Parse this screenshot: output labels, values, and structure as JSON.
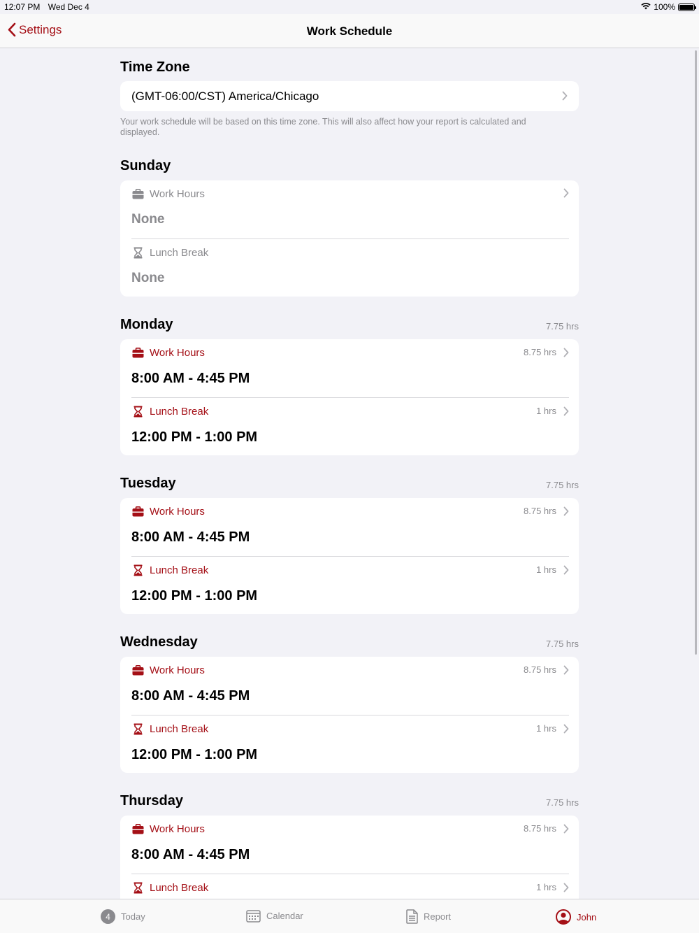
{
  "status_bar": {
    "time": "12:07 PM",
    "date": "Wed Dec 4",
    "battery": "100%"
  },
  "nav": {
    "back_label": "Settings",
    "title": "Work Schedule"
  },
  "time_zone": {
    "header": "Time Zone",
    "value": "(GMT-06:00/CST) America/Chicago",
    "footer": "Your work schedule will be based on this time zone. This will also affect how your report is calculated and displayed."
  },
  "days": [
    {
      "name": "Sunday",
      "total": "",
      "work": {
        "label": "Work Hours",
        "hours": "",
        "value": "None"
      },
      "lunch": {
        "label": "Lunch Break",
        "hours": "",
        "value": "None"
      }
    },
    {
      "name": "Monday",
      "total": "7.75 hrs",
      "work": {
        "label": "Work Hours",
        "hours": "8.75 hrs",
        "value": "8:00 AM - 4:45 PM"
      },
      "lunch": {
        "label": "Lunch Break",
        "hours": "1 hrs",
        "value": "12:00 PM - 1:00 PM"
      }
    },
    {
      "name": "Tuesday",
      "total": "7.75 hrs",
      "work": {
        "label": "Work Hours",
        "hours": "8.75 hrs",
        "value": "8:00 AM - 4:45 PM"
      },
      "lunch": {
        "label": "Lunch Break",
        "hours": "1 hrs",
        "value": "12:00 PM - 1:00 PM"
      }
    },
    {
      "name": "Wednesday",
      "total": "7.75 hrs",
      "work": {
        "label": "Work Hours",
        "hours": "8.75 hrs",
        "value": "8:00 AM - 4:45 PM"
      },
      "lunch": {
        "label": "Lunch Break",
        "hours": "1 hrs",
        "value": "12:00 PM - 1:00 PM"
      }
    },
    {
      "name": "Thursday",
      "total": "7.75 hrs",
      "work": {
        "label": "Work Hours",
        "hours": "8.75 hrs",
        "value": "8:00 AM - 4:45 PM"
      },
      "lunch": {
        "label": "Lunch Break",
        "hours": "1 hrs",
        "value": ""
      }
    }
  ],
  "tabs": {
    "today": {
      "label": "Today",
      "badge": "4"
    },
    "calendar": {
      "label": "Calendar"
    },
    "report": {
      "label": "Report"
    },
    "john": {
      "label": "John"
    }
  },
  "colors": {
    "accent": "#a40f16",
    "background": "#f2f2f7",
    "secondary_text": "#8a8a8e"
  }
}
